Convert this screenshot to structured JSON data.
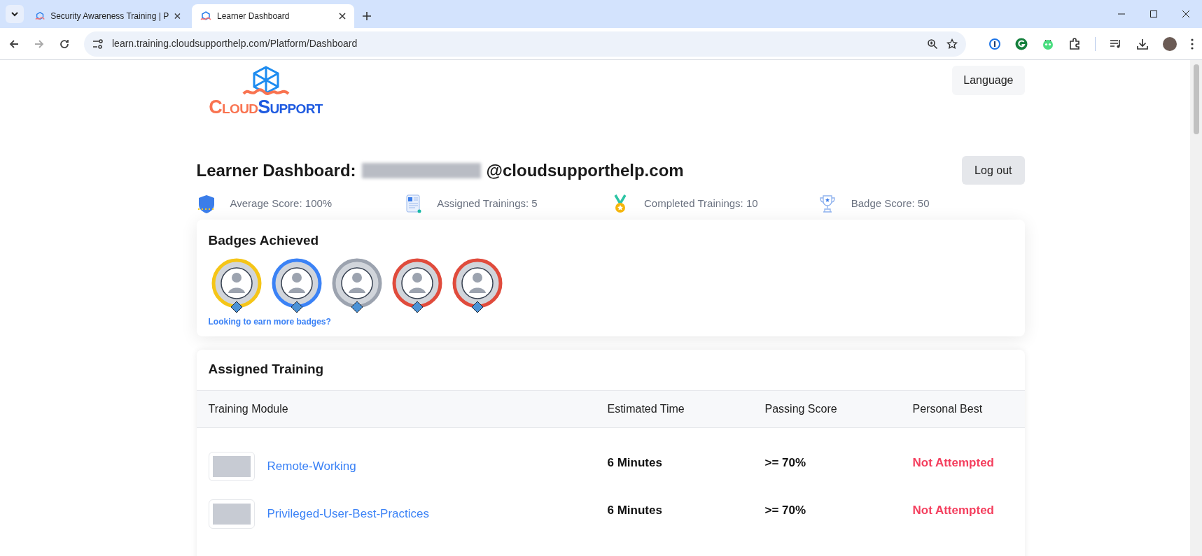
{
  "browser": {
    "tabs": [
      {
        "title": "Security Awareness Training | P",
        "selected": false
      },
      {
        "title": "Learner Dashboard",
        "selected": true
      }
    ],
    "url": "learn.training.cloudsupporthelp.com/Platform/Dashboard"
  },
  "header": {
    "logo_parts": [
      "Cloud",
      "Support"
    ],
    "language_button": "Language"
  },
  "dashboard": {
    "title": "Learner Dashboard:",
    "email_domain": "@cloudsupporthelp.com",
    "logout_button": "Log out",
    "stats": [
      {
        "kind": "shield",
        "label": "Average Score: 100%"
      },
      {
        "kind": "document",
        "label": "Assigned Trainings: 5"
      },
      {
        "kind": "medal",
        "label": "Completed Trainings: 10"
      },
      {
        "kind": "trophy",
        "label": "Badge Score: 50"
      }
    ]
  },
  "badges": {
    "title": "Badges Achieved",
    "link": "Looking to earn more badges?",
    "items": [
      {
        "color": "#f5c518"
      },
      {
        "color": "#3b82f6"
      },
      {
        "color": "#9ca3af"
      },
      {
        "color": "#e04b3c"
      },
      {
        "color": "#e04b3c"
      }
    ]
  },
  "assigned_training": {
    "title": "Assigned Training",
    "columns": [
      "Training Module",
      "Estimated Time",
      "Passing Score",
      "Personal Best"
    ],
    "rows": [
      {
        "module": "Remote-Working",
        "time": "6 Minutes",
        "passing": ">= 70%",
        "best": "Not Attempted"
      },
      {
        "module": "Privileged-User-Best-Practices",
        "time": "6 Minutes",
        "passing": ">= 70%",
        "best": "Not Attempted"
      }
    ]
  }
}
